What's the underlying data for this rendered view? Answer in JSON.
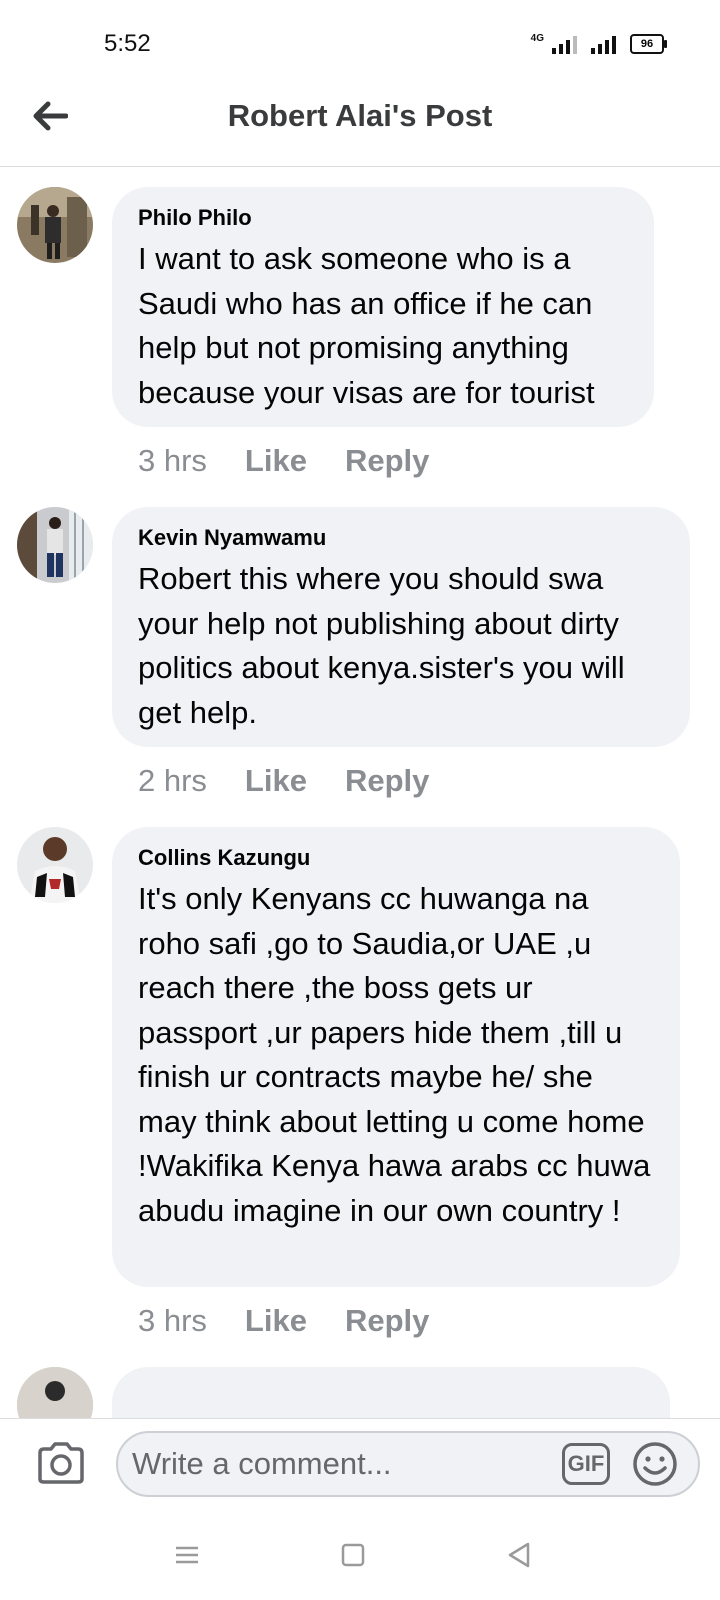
{
  "status_bar": {
    "time": "5:52",
    "network": "4G",
    "battery": "96"
  },
  "header": {
    "title": "Robert Alai's Post"
  },
  "comments": [
    {
      "author": "Philo Philo",
      "text": "I want to ask someone who is a Saudi who has an office if he can help but not promising anything because your visas are for tourist",
      "time": "3 hrs",
      "like": "Like",
      "reply": "Reply"
    },
    {
      "author": "Kevin Nyamwamu",
      "text": "Robert this where you should swa your help not publishing about dirty politics about kenya.sister's you will get help.",
      "time": "2 hrs",
      "like": "Like",
      "reply": "Reply"
    },
    {
      "author": "Collins Kazungu",
      "text": "It's only Kenyans cc huwanga na roho safi ,go to Saudia,or UAE ,u reach there ,the boss gets ur passport ,ur papers hide them ,till u finish ur contracts maybe he/ she may think about letting u come home !Wakifika Kenya hawa arabs cc huwa abudu imagine in our own country !",
      "time": "3 hrs",
      "like": "Like",
      "reply": "Reply"
    }
  ],
  "composer": {
    "placeholder": "Write a comment...",
    "gif_label": "GIF"
  },
  "icons": {
    "back": "arrow-left-icon",
    "camera": "camera-icon",
    "emoji": "smiley-icon",
    "nav": [
      "menu-icon",
      "home-square-icon",
      "back-triangle-icon"
    ]
  },
  "colors": {
    "bubble": "#f0f2f5",
    "meta_text": "#8a8d91",
    "title": "#3a3b3c"
  }
}
